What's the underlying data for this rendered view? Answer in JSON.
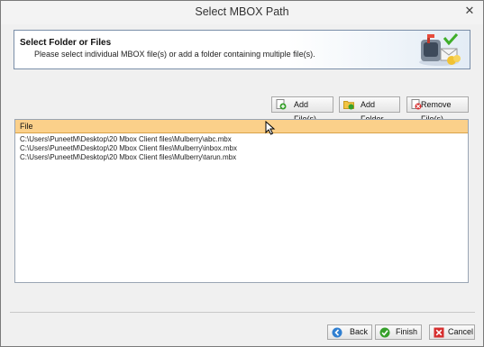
{
  "window": {
    "title": "Select MBOX Path",
    "close_glyph": "✕"
  },
  "header": {
    "title": "Select Folder or Files",
    "subtitle": "Please select individual MBOX file(s) or add a folder containing multiple file(s).",
    "icon": "mailbox-icon"
  },
  "toolbar": {
    "add_files": "Add File(s)",
    "add_folder": "Add Folder",
    "remove_files": "Remove File(s)"
  },
  "file_list": {
    "column_header": "File",
    "rows": [
      "C:\\Users\\PuneetM\\Desktop\\20 Mbox Client files\\Mulberry\\abc.mbx",
      "C:\\Users\\PuneetM\\Desktop\\20 Mbox Client files\\Mulberry\\inbox.mbx",
      "C:\\Users\\PuneetM\\Desktop\\20 Mbox Client files\\Mulberry\\tarun.mbx"
    ]
  },
  "footer": {
    "back_label": "Back",
    "finish_label": "Finish",
    "cancel_label": "Cancel"
  }
}
